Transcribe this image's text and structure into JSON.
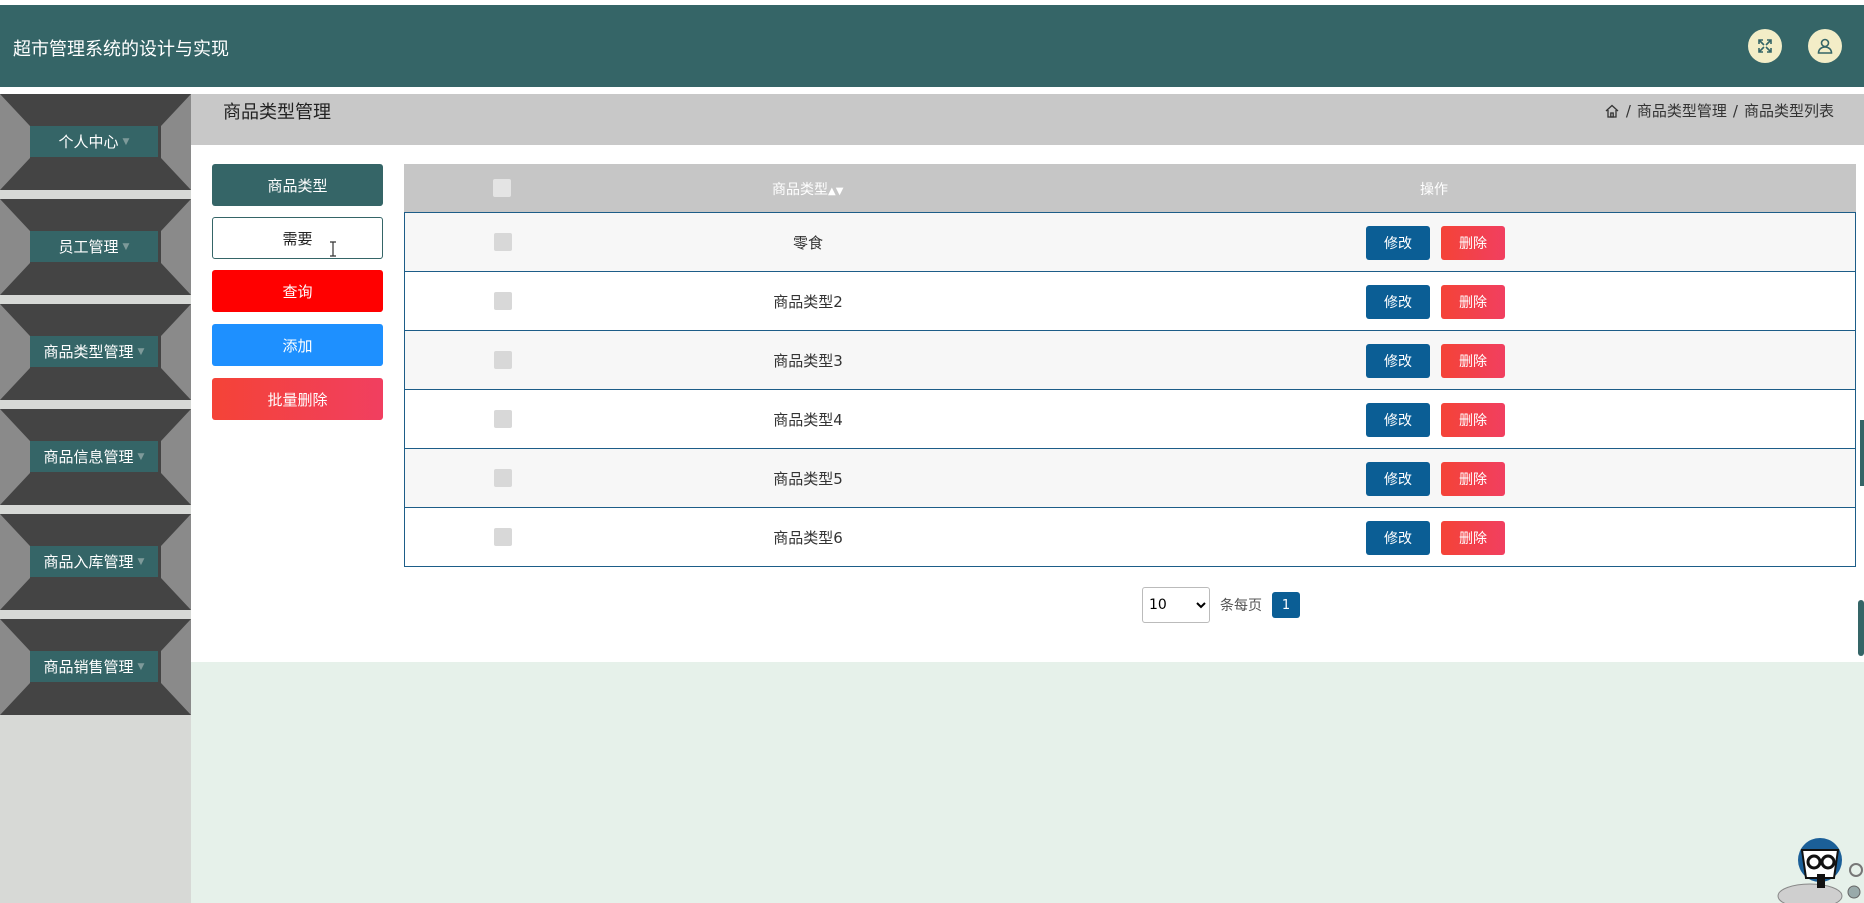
{
  "app": {
    "title": "超市管理系统的设计与实现"
  },
  "header_icons": {
    "fullscreen": "expand-icon",
    "user": "user-icon"
  },
  "sidebar": {
    "items": [
      {
        "label": "个人中心"
      },
      {
        "label": "员工管理"
      },
      {
        "label": "商品类型管理"
      },
      {
        "label": "商品信息管理"
      },
      {
        "label": "商品入库管理"
      },
      {
        "label": "商品销售管理"
      }
    ]
  },
  "page": {
    "title": "商品类型管理",
    "breadcrumb": [
      "商品类型管理",
      "商品类型列表"
    ]
  },
  "search": {
    "label": "商品类型",
    "value": "需要",
    "query_button": "查询",
    "add_button": "添加",
    "batch_delete_button": "批量删除"
  },
  "table": {
    "headers": {
      "type": "商品类型",
      "actions": "操作"
    },
    "rows": [
      {
        "name": "零食"
      },
      {
        "name": "商品类型2"
      },
      {
        "name": "商品类型3"
      },
      {
        "name": "商品类型4"
      },
      {
        "name": "商品类型5"
      },
      {
        "name": "商品类型6"
      }
    ],
    "edit_label": "修改",
    "delete_label": "删除"
  },
  "pagination": {
    "page_size": "10",
    "page_size_label": "条每页",
    "current_page": "1"
  },
  "colors": {
    "header": "#356567",
    "edit": "#0b5e95",
    "delete": "#f44337",
    "query": "#ff0000",
    "add": "#1e90ff"
  }
}
